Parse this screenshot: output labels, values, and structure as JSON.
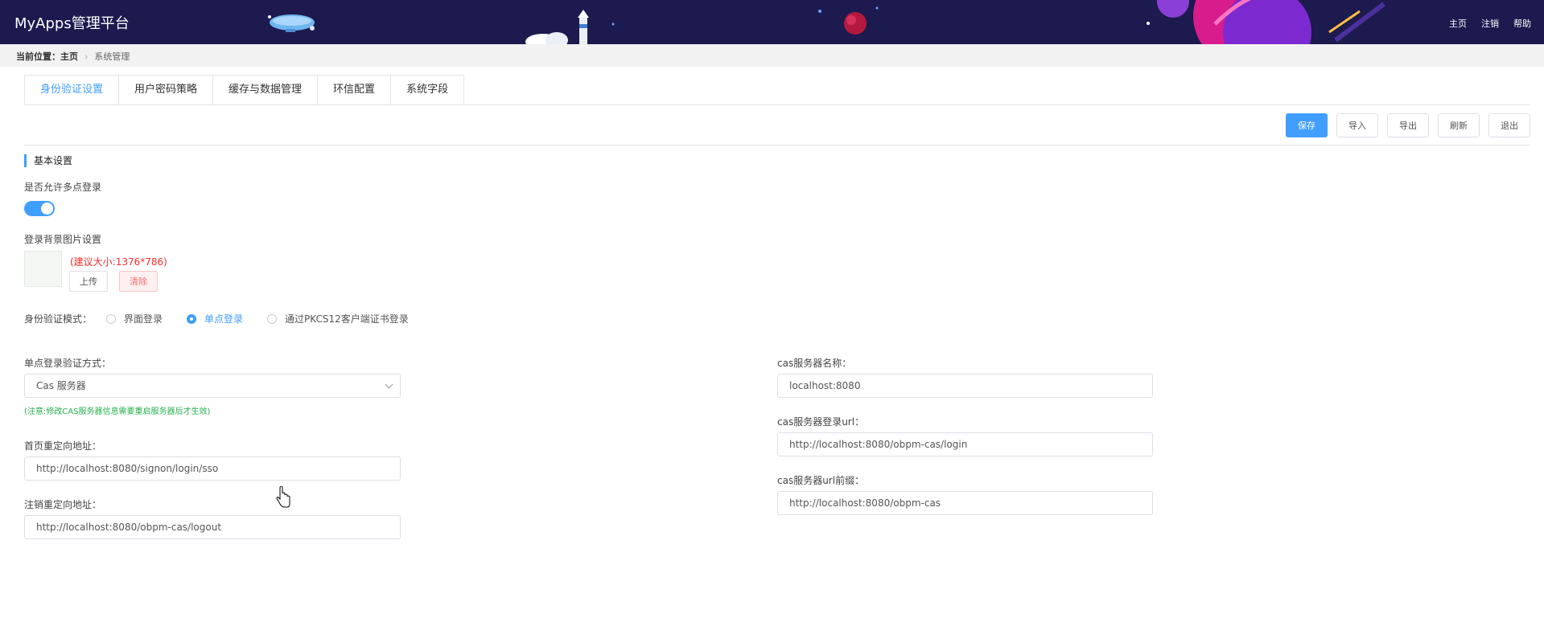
{
  "header": {
    "brand": "MyApps管理平台",
    "nav": [
      "主页",
      "注销",
      "帮助"
    ]
  },
  "breadcrumb": {
    "label": "当前位置：",
    "home": "主页",
    "current": "系统管理"
  },
  "tabs": [
    "身份验证设置",
    "用户密码策略",
    "缓存与数据管理",
    "环信配置",
    "系统字段"
  ],
  "active_tab": "身份验证设置",
  "toolbar": {
    "save": "保存",
    "import": "导入",
    "export": "导出",
    "refresh": "刷新",
    "exit": "退出"
  },
  "section": {
    "title": "基本设置"
  },
  "multi_login": {
    "label": "是否允许多点登录",
    "enabled": true
  },
  "login_bg": {
    "label": "登录背景图片设置",
    "hint": "(建议大小:1376*786)",
    "upload": "上传",
    "clear": "清除"
  },
  "auth_mode": {
    "label": "身份验证模式：",
    "options": [
      "界面登录",
      "单点登录",
      "通过PKCS12客户端证书登录"
    ],
    "selected": "单点登录"
  },
  "sso": {
    "method_label": "单点登录验证方式：",
    "method_value": "Cas 服务器",
    "note": "(注意:修改CAS服务器信息需要重启服务器后才生效)",
    "home_redirect_label": "首页重定向地址：",
    "home_redirect_value": "http://localhost:8080/signon/login/sso",
    "logout_redirect_label": "注销重定向地址：",
    "logout_redirect_value": "http://localhost:8080/obpm-cas/logout"
  },
  "cas": {
    "name_label": "cas服务器名称：",
    "name_value": "localhost:8080",
    "login_url_label": "cas服务器登录url：",
    "login_url_value": "http://localhost:8080/obpm-cas/login",
    "prefix_label": "cas服务器url前缀：",
    "prefix_value": "http://localhost:8080/obpm-cas"
  },
  "colors": {
    "header_bg": "#1d1a4f",
    "accent": "#409eff",
    "danger": "#f56c6c",
    "note_green": "#22b14c"
  }
}
